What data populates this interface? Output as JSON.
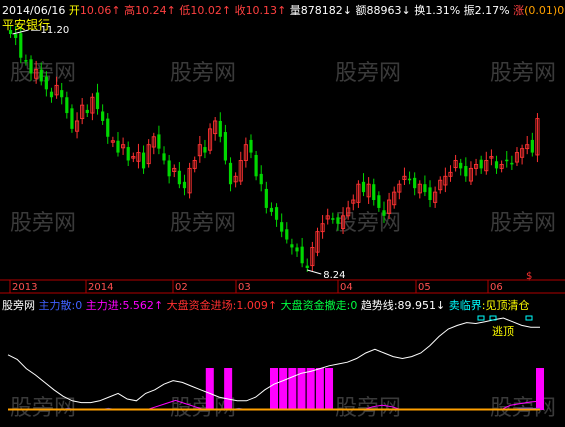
{
  "top_bar": {
    "date": "2014/06/16",
    "open_label": "开",
    "open": "10.06",
    "high_label": "高",
    "high": "10.24",
    "low_label": "低",
    "low": "10.02",
    "close_label": "收",
    "close": "10.13",
    "volume_label": "量",
    "volume": "878182",
    "amount_label": "额",
    "amount": "88963",
    "turnover_label": "换",
    "turnover": "1.31%",
    "amplitude_label": "振",
    "amplitude": "2.17%",
    "change_label": "涨",
    "change": "(0.01)0.10"
  },
  "stock_name": "平安银行",
  "price_labels": {
    "max": "11.20",
    "min": "8.24"
  },
  "time_axis": {
    "labels": [
      "2013",
      "2014",
      "02",
      "03",
      "04",
      "05",
      "06"
    ],
    "marker": "$"
  },
  "indicator_bar": {
    "name": "股旁网",
    "items": [
      {
        "label": "主力散",
        "value": "0"
      },
      {
        "label": "主力进",
        "value": "5.562"
      },
      {
        "label": "大盘资金进场",
        "value": "1.009"
      },
      {
        "label": "大盘资金撤走",
        "value": "0"
      },
      {
        "label": "趋势线",
        "value": "89.951"
      },
      {
        "label": "卖临界",
        "value": "见顶清仓"
      }
    ]
  },
  "annotation": "逃顶",
  "watermark": "股旁网",
  "colors": {
    "bg": "#000000",
    "up": "#ff3232",
    "down": "#00d800",
    "axis": "#b00000",
    "white": "#ffffff",
    "cyan": "#00ffff",
    "yellow": "#ffff00",
    "magenta": "#ff00ff",
    "blue": "#4040ff",
    "orange": "#ffa000"
  },
  "chart_data": [
    {
      "type": "candlestick",
      "title": "平安银行",
      "x_axis": [
        "2013",
        "2014",
        "02",
        "03",
        "04",
        "05",
        "06"
      ],
      "price_range": [
        8.24,
        11.2
      ],
      "annotated_high": 11.2,
      "annotated_low": 8.24,
      "last_bar": {
        "date": "2014/06/16",
        "open": 10.06,
        "high": 10.24,
        "low": 10.02,
        "close": 10.13
      },
      "series": [
        {
          "name": "close",
          "values": [
            11.2,
            11.15,
            10.9,
            10.85,
            10.7,
            10.75,
            10.6,
            10.5,
            10.4,
            10.55,
            10.4,
            10.2,
            10.0,
            10.1,
            10.3,
            10.2,
            10.4,
            10.25,
            10.1,
            9.9,
            9.85,
            9.7,
            9.8,
            9.6,
            9.65,
            9.7,
            9.5,
            9.8,
            9.9,
            9.75,
            9.6,
            9.4,
            9.5,
            9.3,
            9.25,
            9.5,
            9.6,
            9.8,
            9.7,
            10.0,
            10.1,
            9.9,
            9.6,
            9.3,
            9.4,
            9.6,
            9.8,
            9.7,
            9.4,
            9.3,
            9.0,
            8.95,
            8.85,
            8.7,
            8.6,
            8.5,
            8.45,
            8.3,
            8.24,
            8.5,
            8.7,
            8.8,
            8.9,
            8.85,
            8.8,
            8.9,
            9.0,
            9.1,
            9.3,
            9.2,
            9.3,
            9.1,
            9.0,
            8.9,
            9.1,
            9.2,
            9.3,
            9.4,
            9.35,
            9.25,
            9.3,
            9.2,
            9.1,
            9.2,
            9.35,
            9.4,
            9.45,
            9.6,
            9.5,
            9.4,
            9.5,
            9.55,
            9.5,
            9.6,
            9.65,
            9.5,
            9.55,
            9.6,
            9.55,
            9.7,
            9.75,
            9.8,
            9.7,
            10.13
          ]
        }
      ]
    },
    {
      "type": "line",
      "title": "股旁网",
      "series": [
        {
          "name": "趋势线",
          "values": [
            60,
            55,
            45,
            38,
            30,
            22,
            15,
            10,
            8,
            8,
            10,
            14,
            18,
            12,
            10,
            18,
            22,
            28,
            32,
            30,
            26,
            22,
            18,
            14,
            12,
            10,
            10,
            14,
            22,
            28,
            32,
            36,
            40,
            42,
            45,
            48,
            50,
            52,
            56,
            62,
            66,
            62,
            58,
            56,
            58,
            62,
            70,
            80,
            88,
            92,
            95,
            94,
            96,
            98,
            100,
            96,
            92,
            90,
            89.951
          ]
        },
        {
          "name": "主力进",
          "values": [
            0,
            0,
            0,
            0,
            0,
            0,
            0,
            0,
            0,
            0,
            0,
            0,
            0,
            0,
            0,
            2,
            4,
            6,
            4,
            2,
            0,
            0,
            0,
            0,
            0,
            0,
            0,
            0,
            0,
            0,
            0,
            0,
            0,
            0,
            0,
            0,
            0,
            2,
            3,
            2,
            0,
            0,
            0,
            0,
            0,
            0,
            0,
            0,
            0,
            0,
            0,
            3,
            4,
            5,
            5.562
          ]
        },
        {
          "name": "大盘资金进场",
          "values": [
            0,
            0,
            0,
            0,
            0,
            0,
            1,
            0,
            0,
            0,
            1,
            0,
            0,
            0,
            0,
            0,
            0,
            0,
            0,
            0,
            0,
            0,
            0,
            1,
            0,
            0,
            0,
            0,
            0,
            0,
            0,
            0,
            0,
            0,
            0,
            0,
            0,
            0,
            0,
            0,
            0,
            0,
            0,
            0,
            0,
            0,
            0,
            0,
            0,
            0,
            0,
            1,
            1,
            1.009
          ]
        },
        {
          "name": "大盘资金撤走",
          "values": [
            0,
            0,
            0,
            0,
            0,
            0,
            0,
            0,
            0,
            0,
            0,
            0,
            0,
            0,
            0,
            0,
            0,
            0,
            0,
            0,
            0,
            0,
            0,
            0,
            0,
            0,
            0,
            0,
            0,
            0,
            0,
            0,
            0,
            0,
            0,
            0,
            0,
            0,
            0,
            0,
            0,
            0,
            0,
            0,
            0,
            0,
            0,
            0,
            0,
            0,
            0,
            0,
            0,
            0
          ]
        }
      ],
      "signals": [
        {
          "name": "主力散",
          "x": [
            22,
            24,
            29,
            30,
            31,
            32,
            33,
            34,
            35,
            58
          ]
        }
      ],
      "y_range": [
        0,
        100
      ]
    }
  ]
}
